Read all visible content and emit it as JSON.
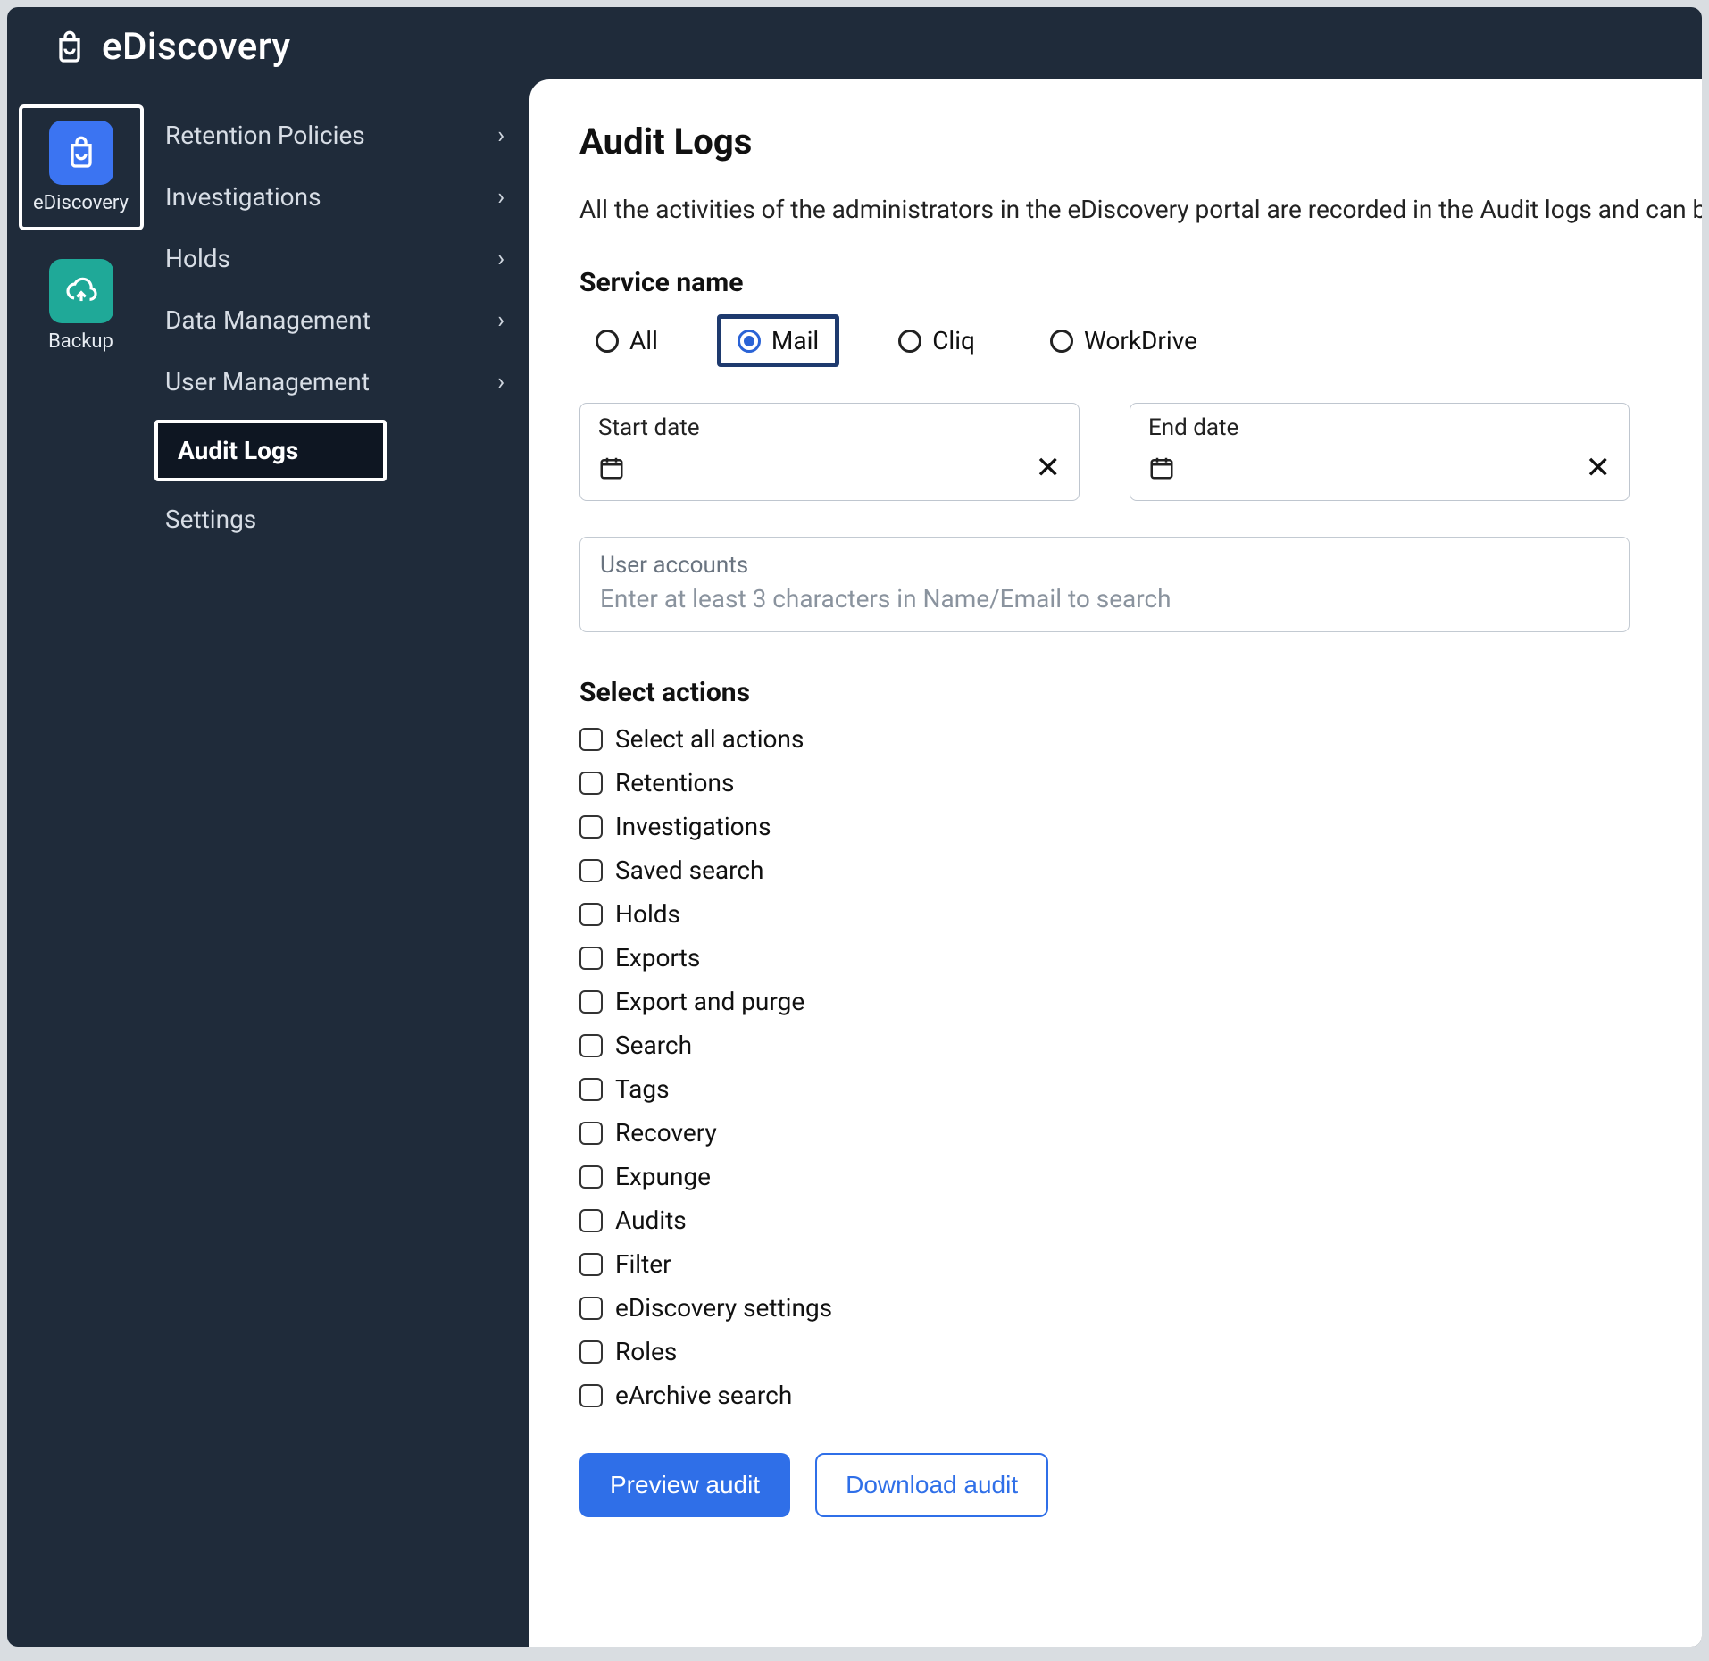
{
  "header": {
    "title": "eDiscovery"
  },
  "rail": [
    {
      "key": "ediscovery",
      "label": "eDiscovery",
      "color": "blue",
      "highlighted": true
    },
    {
      "key": "backup",
      "label": "Backup",
      "color": "green",
      "highlighted": false
    }
  ],
  "nav": {
    "items": [
      {
        "label": "Retention Policies",
        "expandable": true
      },
      {
        "label": "Investigations",
        "expandable": true
      },
      {
        "label": "Holds",
        "expandable": true
      },
      {
        "label": "Data Management",
        "expandable": true
      },
      {
        "label": "User Management",
        "expandable": true
      },
      {
        "label": "Audit Logs",
        "expandable": false,
        "active": true
      },
      {
        "label": "Settings",
        "expandable": false
      }
    ]
  },
  "page": {
    "title": "Audit Logs",
    "description": "All the activities of the administrators in the eDiscovery portal are recorded in the Audit logs and can be"
  },
  "service": {
    "label": "Service name",
    "options": [
      {
        "label": "All",
        "selected": false
      },
      {
        "label": "Mail",
        "selected": true
      },
      {
        "label": "Cliq",
        "selected": false
      },
      {
        "label": "WorkDrive",
        "selected": false
      }
    ]
  },
  "dates": {
    "start_label": "Start date",
    "end_label": "End date"
  },
  "accounts": {
    "label": "User accounts",
    "placeholder": "Enter at least 3 characters in Name/Email to search"
  },
  "actions": {
    "label": "Select actions",
    "items": [
      "Select all actions",
      "Retentions",
      "Investigations",
      "Saved search",
      "Holds",
      "Exports",
      "Export and purge",
      "Search",
      "Tags",
      "Recovery",
      "Expunge",
      "Audits",
      "Filter",
      "eDiscovery settings",
      "Roles",
      "eArchive search"
    ]
  },
  "buttons": {
    "preview": "Preview audit",
    "download": "Download audit"
  }
}
